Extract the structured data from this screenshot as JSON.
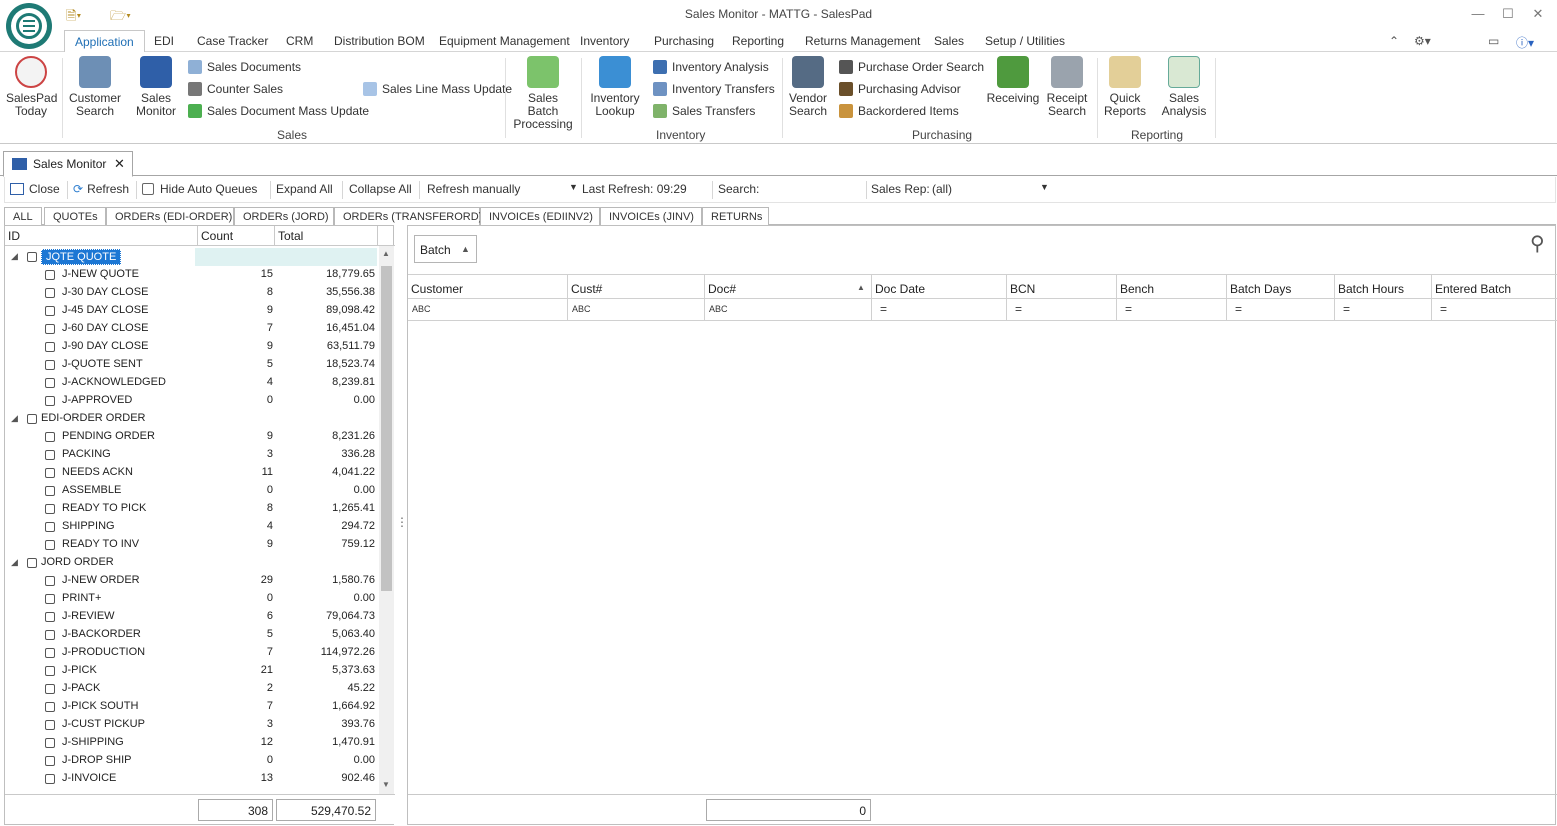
{
  "window": {
    "title": "Sales Monitor - MATTG - SalesPad"
  },
  "menu": [
    "Application",
    "EDI",
    "Case Tracker",
    "CRM",
    "Distribution BOM",
    "Equipment Management",
    "Inventory",
    "Purchasing",
    "Reporting",
    "Returns Management",
    "Sales",
    "Setup / Utilities"
  ],
  "ribbon": {
    "salespad_today": [
      "SalesPad",
      "Today"
    ],
    "customer_search": [
      "Customer",
      "Search"
    ],
    "sales_monitor": [
      "Sales",
      "Monitor"
    ],
    "sales_documents": "Sales Documents",
    "counter_sales": "Counter Sales",
    "sales_document_mass_update": "Sales Document Mass Update",
    "sales_line_mass_update": "Sales Line Mass Update",
    "group_sales": "Sales",
    "sales_batch_processing": [
      "Sales Batch",
      "Processing"
    ],
    "inventory_lookup": [
      "Inventory",
      "Lookup"
    ],
    "inventory_analysis": "Inventory Analysis",
    "inventory_transfers": "Inventory Transfers",
    "sales_transfers": "Sales Transfers",
    "group_inventory": "Inventory",
    "vendor_search": [
      "Vendor",
      "Search"
    ],
    "purchase_order_search": "Purchase Order Search",
    "purchasing_advisor": "Purchasing Advisor",
    "backordered_items": "Backordered Items",
    "group_purchasing": "Purchasing",
    "receiving": "Receiving",
    "receipt_search": [
      "Receipt",
      "Search"
    ],
    "quick_reports": [
      "Quick",
      "Reports"
    ],
    "sales_analysis": [
      "Sales",
      "Analysis"
    ],
    "group_reporting": "Reporting"
  },
  "doc_tab": {
    "label": "Sales Monitor"
  },
  "toolbar": {
    "close": "Close",
    "refresh": "Refresh",
    "hide_auto_queues": "Hide Auto Queues",
    "expand_all": "Expand All",
    "collapse_all": "Collapse All",
    "refresh_mode": "Refresh manually",
    "last_refresh": "Last Refresh: 09:29",
    "search_label": "Search:",
    "sales_rep_label": "Sales Rep:",
    "sales_rep_value": "(all)"
  },
  "filter_tabs": [
    "ALL",
    "QUOTEs",
    "ORDERs (EDI-ORDER)",
    "ORDERs (JORD)",
    "ORDERs (TRANSFERORD)",
    "INVOICEs (EDIINV2)",
    "INVOICEs (JINV)",
    "RETURNs"
  ],
  "left_grid": {
    "headers": [
      "ID",
      "Count",
      "Total"
    ],
    "rows": [
      {
        "group": true,
        "label": "JQTE QUOTE",
        "count": "",
        "total": ""
      },
      {
        "label": "J-NEW QUOTE",
        "count": "15",
        "total": "18,779.65"
      },
      {
        "label": "J-30 DAY CLOSE",
        "count": "8",
        "total": "35,556.38"
      },
      {
        "label": "J-45 DAY CLOSE",
        "count": "9",
        "total": "89,098.42"
      },
      {
        "label": "J-60 DAY CLOSE",
        "count": "7",
        "total": "16,451.04"
      },
      {
        "label": "J-90 DAY CLOSE",
        "count": "9",
        "total": "63,511.79"
      },
      {
        "label": "J-QUOTE SENT",
        "count": "5",
        "total": "18,523.74"
      },
      {
        "label": "J-ACKNOWLEDGED",
        "count": "4",
        "total": "8,239.81"
      },
      {
        "label": "J-APPROVED",
        "count": "0",
        "total": "0.00"
      },
      {
        "group": true,
        "label": "EDI-ORDER ORDER",
        "count": "",
        "total": ""
      },
      {
        "label": "PENDING ORDER",
        "count": "9",
        "total": "8,231.26"
      },
      {
        "label": "PACKING",
        "count": "3",
        "total": "336.28"
      },
      {
        "label": "NEEDS ACKN",
        "count": "11",
        "total": "4,041.22"
      },
      {
        "label": "ASSEMBLE",
        "count": "0",
        "total": "0.00"
      },
      {
        "label": "READY TO PICK",
        "count": "8",
        "total": "1,265.41"
      },
      {
        "label": "SHIPPING",
        "count": "4",
        "total": "294.72"
      },
      {
        "label": "READY TO INV",
        "count": "9",
        "total": "759.12"
      },
      {
        "group": true,
        "label": "JORD ORDER",
        "count": "",
        "total": ""
      },
      {
        "label": "J-NEW ORDER",
        "count": "29",
        "total": "1,580.76"
      },
      {
        "label": "PRINT+",
        "count": "0",
        "total": "0.00"
      },
      {
        "label": "J-REVIEW",
        "count": "6",
        "total": "79,064.73"
      },
      {
        "label": "J-BACKORDER",
        "count": "5",
        "total": "5,063.40"
      },
      {
        "label": "J-PRODUCTION",
        "count": "7",
        "total": "114,972.26"
      },
      {
        "label": "J-PICK",
        "count": "21",
        "total": "5,373.63"
      },
      {
        "label": "J-PACK",
        "count": "2",
        "total": "45.22"
      },
      {
        "label": "J-PICK SOUTH",
        "count": "7",
        "total": "1,664.92"
      },
      {
        "label": "J-CUST PICKUP",
        "count": "3",
        "total": "393.76"
      },
      {
        "label": "J-SHIPPING",
        "count": "12",
        "total": "1,470.91"
      },
      {
        "label": "J-DROP SHIP",
        "count": "0",
        "total": "0.00"
      },
      {
        "label": "J-INVOICE",
        "count": "13",
        "total": "902.46"
      }
    ],
    "footer_count": "308",
    "footer_total": "529,470.52"
  },
  "right_grid": {
    "group_by": "Batch",
    "headers": [
      "Customer",
      "Cust#",
      "Doc#",
      "Doc Date",
      "BCN",
      "Bench",
      "Batch Days",
      "Batch Hours",
      "Entered Batch"
    ],
    "filter_glyphs": [
      "ABC",
      "ABC",
      "ABC",
      "=",
      "=",
      "=",
      "=",
      "=",
      "="
    ],
    "footer_count": "0"
  },
  "icons": {
    "search": "magnifier-icon",
    "sort_asc": "triangle-up-icon"
  }
}
